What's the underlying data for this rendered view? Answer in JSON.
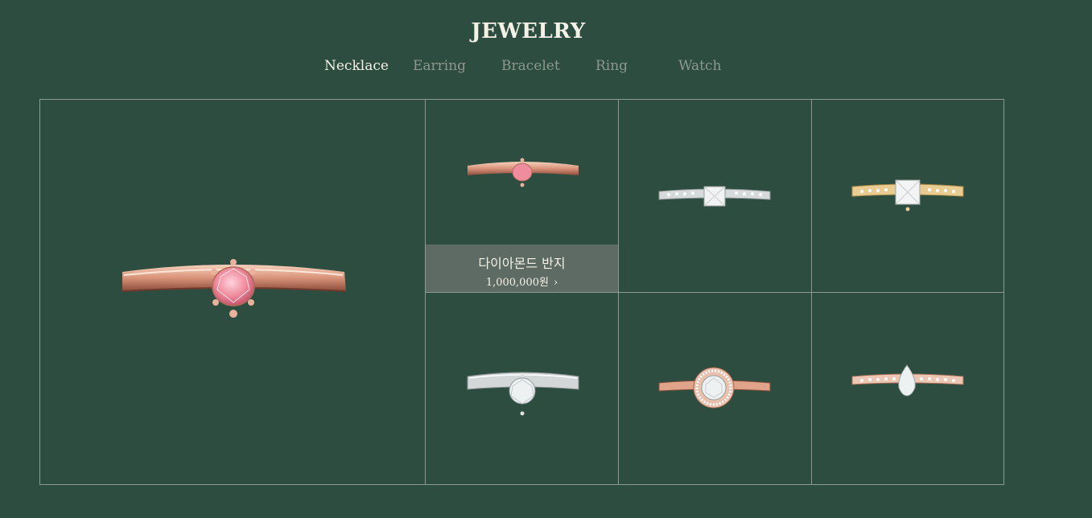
{
  "header": {
    "title": "JEWELRY"
  },
  "tabs": [
    {
      "label": "Necklace",
      "active": true
    },
    {
      "label": "Earring",
      "active": false
    },
    {
      "label": "Bracelet",
      "active": false
    },
    {
      "label": "Ring",
      "active": false
    },
    {
      "label": "Watch",
      "active": false
    }
  ],
  "colors": {
    "background": "#2d4d40",
    "grid_line": "#8b9b92",
    "caption_bg": "#5e6b64",
    "active_tab": "#f4f1e6",
    "inactive_tab": "#8d988f"
  },
  "featured": {
    "icon": "rose-gold-pink-solitaire-ring-icon"
  },
  "products": [
    {
      "icon": "rose-gold-pink-solitaire-ring-icon",
      "name": "다이아몬드 반지",
      "price": "1,000,000원",
      "arrow": "›"
    },
    {
      "icon": "white-gold-princess-pave-ring-icon"
    },
    {
      "icon": "yellow-gold-princess-pave-ring-icon"
    },
    {
      "icon": "white-gold-solitaire-ring-icon"
    },
    {
      "icon": "rose-gold-halo-ring-icon"
    },
    {
      "icon": "rose-gold-pear-pave-ring-icon"
    }
  ]
}
